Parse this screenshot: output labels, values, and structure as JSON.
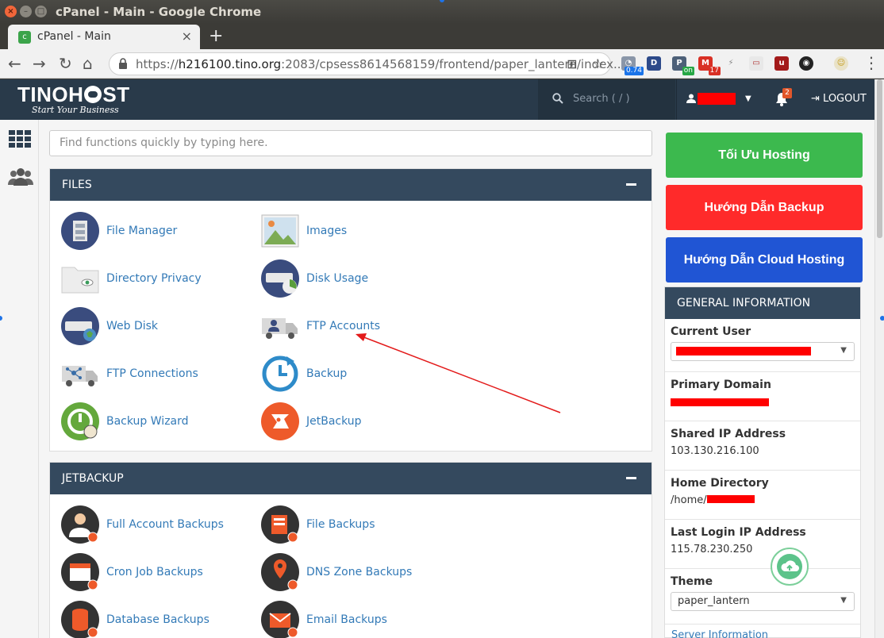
{
  "window": {
    "title": "cPanel - Main - Google Chrome"
  },
  "browser": {
    "tab_title": "cPanel - Main",
    "url_prefix": "https://",
    "url_host": "h216100.tino.org",
    "url_rest": ":2083/cpsess8614568159/frontend/paper_lantern/index...",
    "ext_badge_1": "0.74",
    "ext_badge_2": "on",
    "ext_badge_3": "17"
  },
  "header": {
    "logo_text_a": "TINOH",
    "logo_text_b": "ST",
    "logo_tagline": "Start Your Business",
    "search_placeholder": "Search ( / )",
    "notification_count": "2",
    "logout_label": "LOGOUT"
  },
  "main": {
    "quick_search_placeholder": "Find functions quickly by typing here.",
    "files": {
      "title": "FILES",
      "items": [
        "File Manager",
        "Images",
        "Directory Privacy",
        "Disk Usage",
        "Web Disk",
        "FTP Accounts",
        "FTP Connections",
        "Backup",
        "Backup Wizard",
        "JetBackup"
      ]
    },
    "jetbackup": {
      "title": "JETBACKUP",
      "items": [
        "Full Account Backups",
        "File Backups",
        "Cron Job Backups",
        "DNS Zone Backups",
        "Database Backups",
        "Email Backups"
      ]
    }
  },
  "sidebar_right": {
    "buttons": [
      {
        "label": "Tối Ưu Hosting",
        "color": "#3cb94e"
      },
      {
        "label": "Hướng Dẫn Backup",
        "color": "#ff2a2a"
      },
      {
        "label": "Hướng Dẫn Cloud Hosting",
        "color": "#2055d4"
      }
    ],
    "general_info": {
      "title": "GENERAL INFORMATION",
      "current_user_label": "Current User",
      "primary_domain_label": "Primary Domain",
      "shared_ip_label": "Shared IP Address",
      "shared_ip_value": "103.130.216.100",
      "home_dir_label": "Home Directory",
      "home_dir_prefix": "/home/",
      "last_login_label": "Last Login IP Address",
      "last_login_value": "115.78.230.250",
      "theme_label": "Theme",
      "theme_value": "paper_lantern",
      "server_info_link": "Server Information"
    }
  },
  "colors": {
    "header_bg": "#293a4a",
    "panel_head": "#34495e",
    "link": "#337ab7",
    "annotation_arrow": "#e31a1a"
  }
}
